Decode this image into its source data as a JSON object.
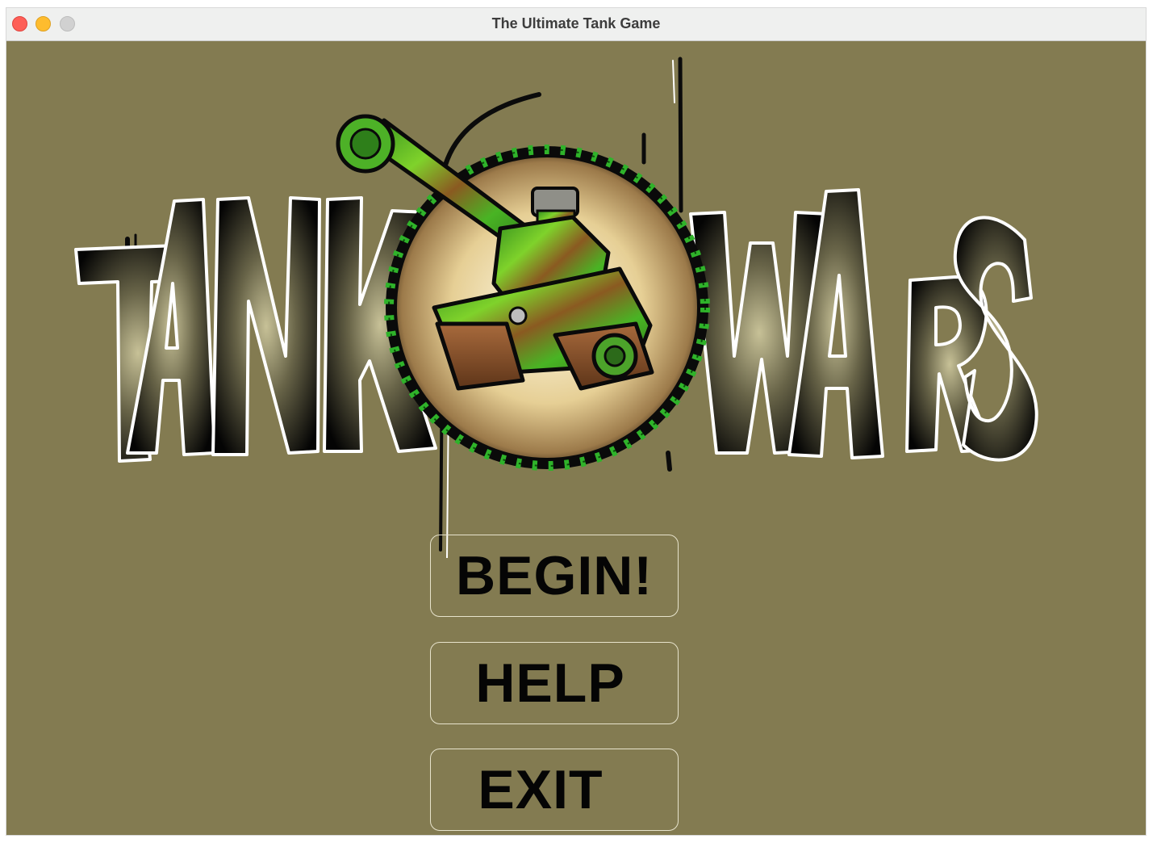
{
  "window": {
    "title": "The Ultimate Tank Game",
    "controls": [
      "close",
      "minimize",
      "maximize"
    ]
  },
  "logo": {
    "left_word": "TANK",
    "right_word": "WARS",
    "emblem_icon": "tank-icon"
  },
  "menu": {
    "begin_label": "BEGIN!",
    "help_label": "HELP",
    "exit_label": "EXIT"
  },
  "colors": {
    "background": "#837b51",
    "titlebar": "#eff0ef",
    "button_border": "#e7e3cc",
    "button_text": "#050505",
    "emblem_green": "#3aa12c"
  }
}
